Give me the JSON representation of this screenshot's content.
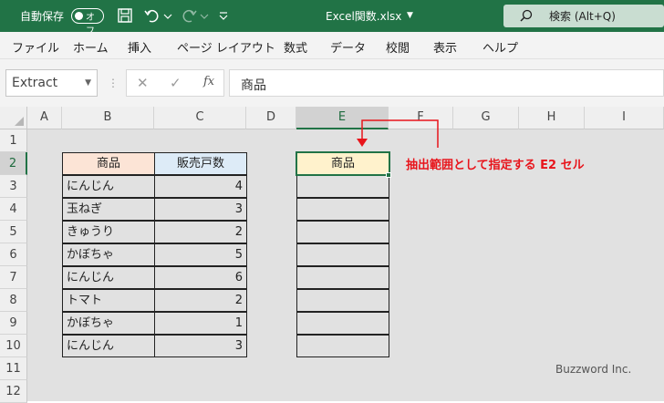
{
  "titlebar": {
    "autosave_label": "自動保存",
    "autosave_state": "オフ",
    "filename": "Excel関数.xlsx",
    "search_label": "検索 (Alt+Q)",
    "accent": "#217346"
  },
  "menu": [
    "ファイル",
    "ホーム",
    "挿入",
    "ページ レイアウト",
    "数式",
    "データ",
    "校閲",
    "表示",
    "ヘルプ"
  ],
  "formula_bar": {
    "name_box": "Extract",
    "fx_label": "fx",
    "content": "商品"
  },
  "columns": [
    "A",
    "B",
    "C",
    "D",
    "E",
    "F",
    "G",
    "H",
    "I"
  ],
  "rows": [
    "1",
    "2",
    "3",
    "4",
    "5",
    "6",
    "7",
    "8",
    "9",
    "10",
    "11",
    "12"
  ],
  "table": {
    "headers": [
      "商品",
      "販売戸数"
    ],
    "rows": [
      [
        "にんじん",
        "4"
      ],
      [
        "玉ねぎ",
        "3"
      ],
      [
        "きゅうり",
        "2"
      ],
      [
        "かぼちゃ",
        "5"
      ],
      [
        "にんじん",
        "6"
      ],
      [
        "トマト",
        "2"
      ],
      [
        "かぼちゃ",
        "1"
      ],
      [
        "にんじん",
        "3"
      ]
    ],
    "header_colors": [
      "#fce4d6",
      "#ddebf7"
    ]
  },
  "extract_range": {
    "header": "商品",
    "header_color": "#fff2cc",
    "empty_rows": 8
  },
  "annotation": {
    "text": "抽出範囲として指定する E2 セル",
    "color": "#e8141b"
  },
  "watermark": "Buzzword Inc."
}
